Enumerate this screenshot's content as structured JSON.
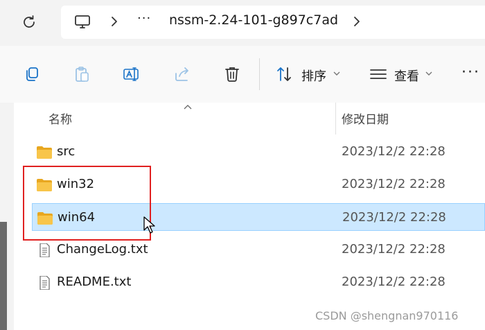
{
  "address_bar": {
    "ellipsis": "···",
    "current_folder": "nssm-2.24-101-g897c7ad"
  },
  "toolbar": {
    "sort_label": "排序",
    "view_label": "查看",
    "more_label": "···"
  },
  "columns": {
    "name": "名称",
    "date_modified": "修改日期"
  },
  "files": [
    {
      "name": "src",
      "date": "2023/12/2 22:28",
      "type": "folder"
    },
    {
      "name": "win32",
      "date": "2023/12/2 22:28",
      "type": "folder"
    },
    {
      "name": "win64",
      "date": "2023/12/2 22:28",
      "type": "folder",
      "selected": true
    },
    {
      "name": "ChangeLog.txt",
      "date": "2023/12/2 22:28",
      "type": "text"
    },
    {
      "name": "README.txt",
      "date": "2023/12/2 22:28",
      "type": "text"
    }
  ],
  "watermark": "CSDN @shengnan970116",
  "colors": {
    "selection_bg": "#cce8ff",
    "selection_border": "#99d1ff",
    "highlight_box": "#e02020",
    "folder": "#f8c54a"
  }
}
